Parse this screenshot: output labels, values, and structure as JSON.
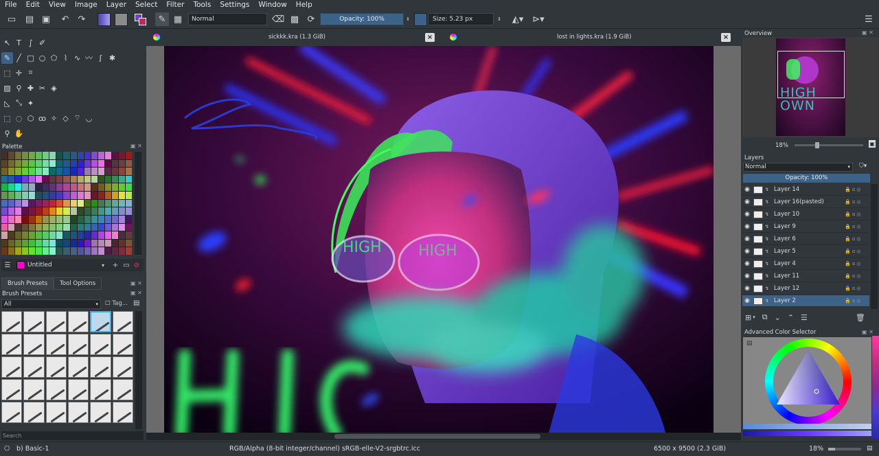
{
  "menubar": {
    "items": [
      "File",
      "Edit",
      "View",
      "Image",
      "Layer",
      "Select",
      "Filter",
      "Tools",
      "Settings",
      "Window",
      "Help"
    ]
  },
  "toolbar": {
    "blend_mode": "Normal",
    "opacity_label": "Opacity:  100%",
    "size_label": "Size:  5.23 px",
    "foreground_color": "#7a6fd0",
    "background_color": "#8a8a8a"
  },
  "tools": {
    "rows": [
      [
        "pointer-icon",
        "text-icon",
        "calligraphy-icon",
        "path-edit-icon"
      ],
      [
        "brush-icon",
        "line-icon",
        "rectangle-icon",
        "ellipse-icon",
        "polygon-icon",
        "polyline-icon",
        "bezier-icon",
        "freehand-path-icon",
        "dynamic-brush-icon",
        "multibrush-icon"
      ],
      [
        "transform-icon",
        "move-icon",
        "crop-icon"
      ],
      [
        "gradient-icon",
        "color-picker-icon",
        "smart-patch-icon",
        "colorize-mask-icon",
        "fill-icon"
      ],
      [
        "assistant-icon",
        "measure-icon",
        "reference-icon"
      ],
      [
        "rect-select-icon",
        "ellipse-select-icon",
        "polygon-select-icon",
        "freehand-select-icon",
        "contiguous-select-icon",
        "similar-select-icon",
        "bezier-select-icon",
        "magnetic-select-icon"
      ],
      [
        "zoom-icon",
        "pan-icon"
      ]
    ]
  },
  "palette": {
    "title": "Palette",
    "name": "Untitled",
    "current_color": "#ff00cc"
  },
  "brush_presets": {
    "tabs": [
      "Brush Presets",
      "Tool Options"
    ],
    "title": "Brush Presets",
    "filter": "All",
    "tag_label": "Tag..."
  },
  "search": {
    "placeholder": "Search"
  },
  "documents": [
    {
      "title": "sickkk.kra (1.3 GiB)"
    },
    {
      "title": "lost in lights.kra (1.9 GiB)"
    }
  ],
  "overview": {
    "title": "Overview",
    "zoom": "18%"
  },
  "layers": {
    "title": "Layers",
    "blend_mode": "Normal",
    "opacity_label": "Opacity:  100%",
    "items": [
      {
        "name": "Layer 14"
      },
      {
        "name": "Layer 16(pasted)"
      },
      {
        "name": "Layer 10"
      },
      {
        "name": "Layer 9"
      },
      {
        "name": "Layer 6"
      },
      {
        "name": "Layer 5"
      },
      {
        "name": "Layer 4"
      },
      {
        "name": "Layer 11"
      },
      {
        "name": "Layer 12"
      },
      {
        "name": "Layer 2"
      }
    ],
    "selected_index": 9
  },
  "color_selector": {
    "title": "Advanced Color Selector"
  },
  "status": {
    "brush": "b) Basic-1",
    "color_model": "RGB/Alpha (8-bit integer/channel)  sRGB-elle-V2-srgbtrc.icc",
    "image_size": "6500 x 9500 (2.3 GiB)",
    "zoom": "18%"
  },
  "colors": {
    "accent": "#3d6288",
    "background": "#31363b"
  }
}
